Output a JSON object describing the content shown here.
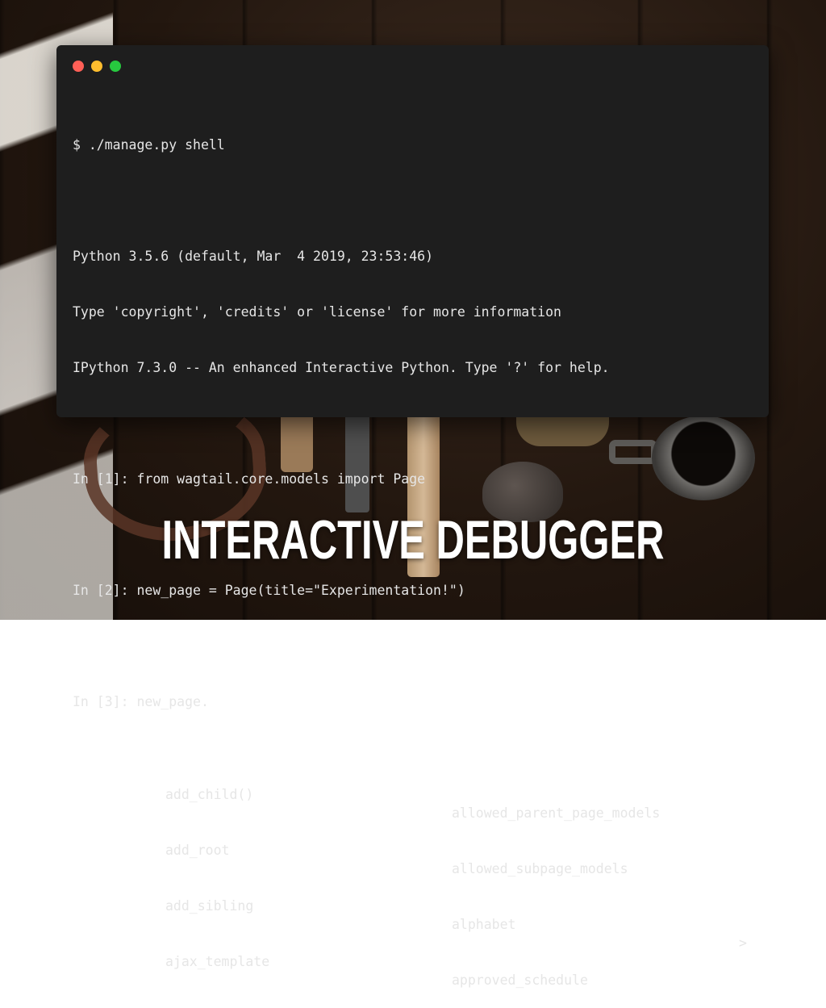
{
  "terminal": {
    "prompt_command": "$ ./manage.py shell",
    "banner": [
      "Python 3.5.6 (default, Mar  4 2019, 23:53:46)",
      "Type 'copyright', 'credits' or 'license' for more information",
      "IPython 7.3.0 -- An enhanced Interactive Python. Type '?' for help."
    ],
    "inputs": [
      "In [1]: from wagtail.core.models import Page",
      "In [2]: new_page = Page(title=\"Experimentation!\")",
      "In [3]: new_page."
    ],
    "completions": [
      {
        "left": "add_child()",
        "right": "allowed_parent_page_models"
      },
      {
        "left": "add_root",
        "right": "allowed_subpage_models"
      },
      {
        "left": "add_sibling",
        "right": "alphabet"
      },
      {
        "left": "ajax_template",
        "right": "approved_schedule"
      }
    ],
    "more_indicator": ">"
  },
  "slide_title": "INTERACTIVE DEBUGGER",
  "colors": {
    "terminal_bg": "#1e1e1e",
    "terminal_text": "#e6e6e6",
    "close": "#ff5f56",
    "minimize": "#ffbd2e",
    "maximize": "#27c93f"
  }
}
